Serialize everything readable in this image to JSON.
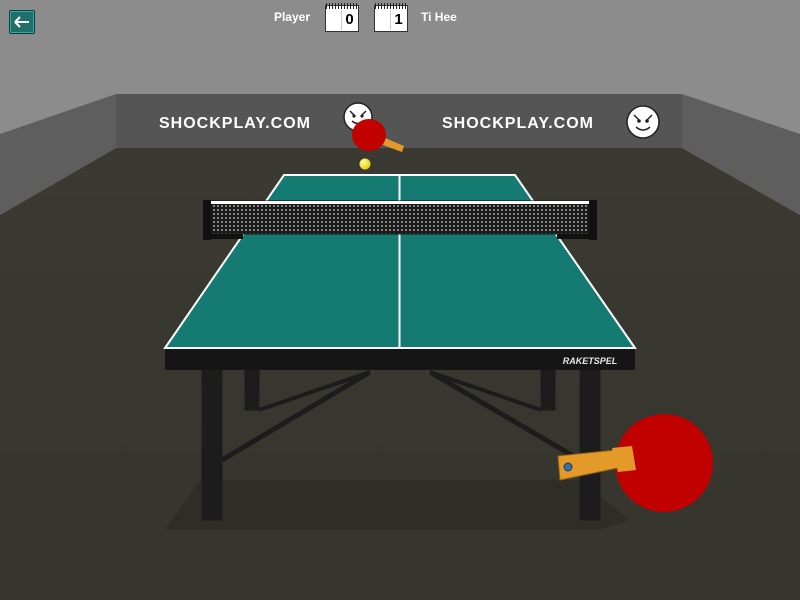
{
  "header": {
    "back_button_icon": "back-arrow-icon",
    "player_name": "Player",
    "player_score": "0",
    "opponent_name": "Ti Hee",
    "opponent_score": "1"
  },
  "banner": {
    "brand_left": "SHOCKPLAY.COM",
    "brand_right": "SHOCKPLAY.COM",
    "mascot_icon": "tiger-mascot-icon"
  },
  "table": {
    "brand_label": "RAKETSPEL",
    "table_color": "#157a72",
    "line_color": "#ffffff"
  },
  "paddles": {
    "opponent_paddle_icon": "table-tennis-paddle-icon",
    "player_paddle_icon": "table-tennis-paddle-icon",
    "rubber_color": "#c10000",
    "handle_color": "#e39a28"
  },
  "ball": {
    "color": "#f2e600",
    "icon": "ball-icon"
  },
  "colors": {
    "wall": "#8c8c8c",
    "side_wall": "#5c5c5c",
    "banner": "#555555",
    "floor": "#3a3a32"
  }
}
